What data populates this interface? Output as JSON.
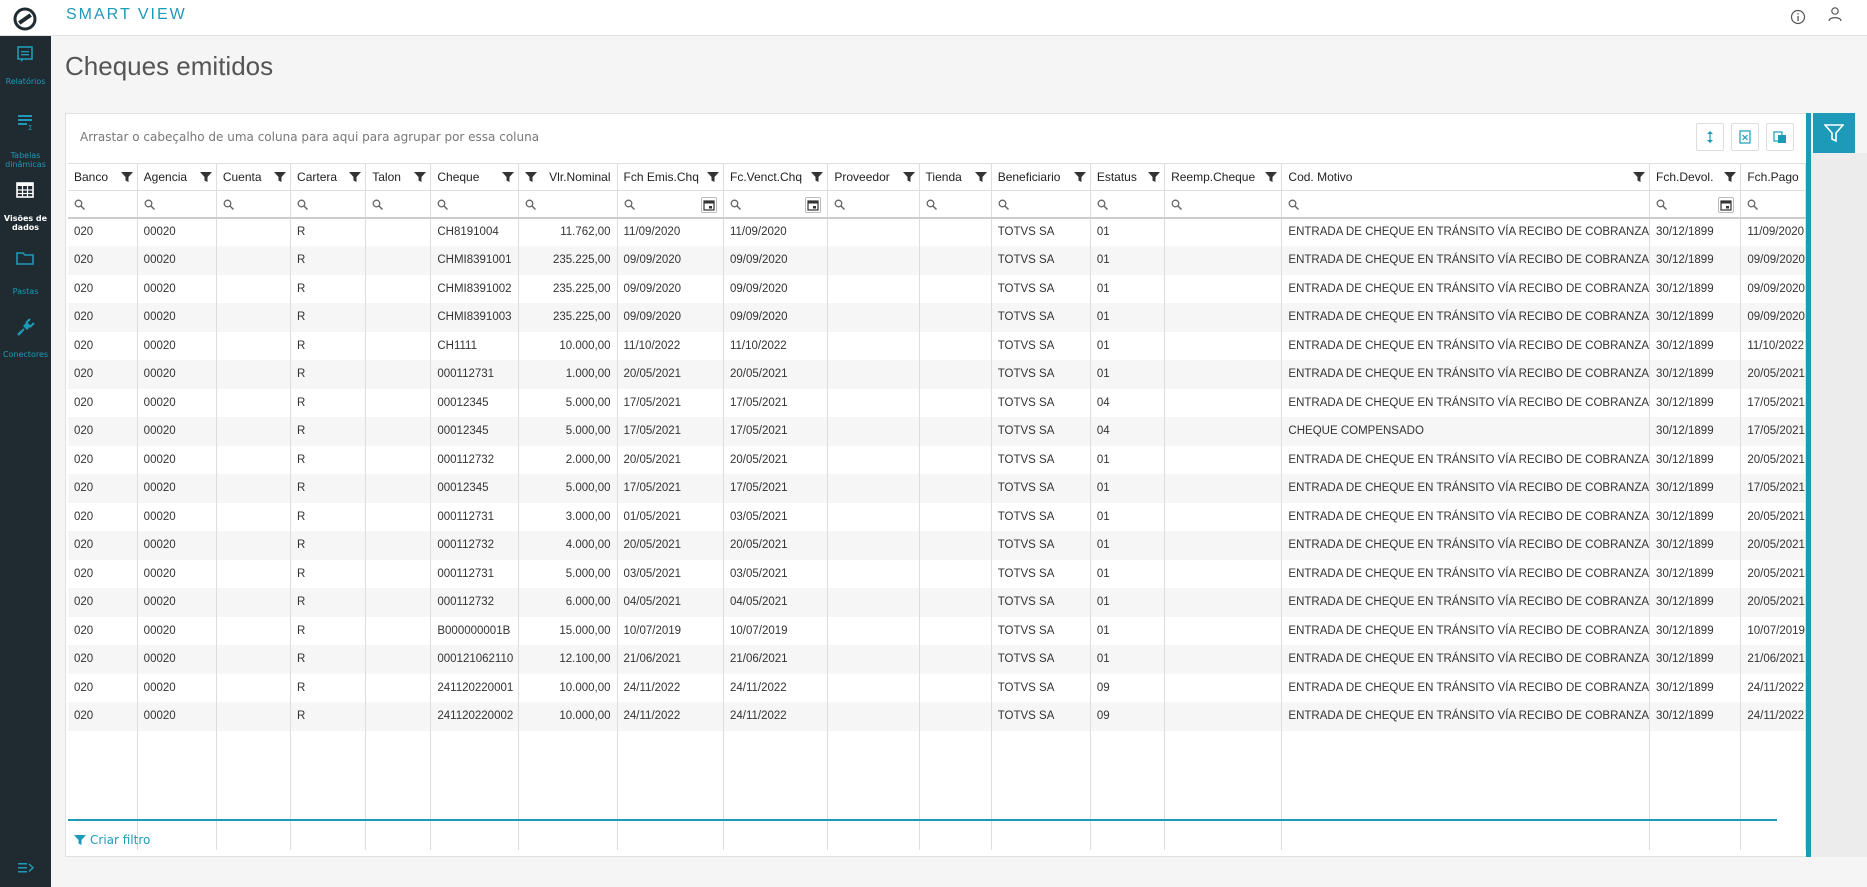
{
  "app": {
    "title": "SMART VIEW"
  },
  "topbar": {
    "icons": [
      "info-icon",
      "user-icon"
    ]
  },
  "sidenav": {
    "items": [
      {
        "label": "Relatórios",
        "icon": "report-icon"
      },
      {
        "label": "Tabelas dinâmicas",
        "icon": "pivot-table-icon"
      },
      {
        "label": "Visões de dados",
        "icon": "data-grid-icon",
        "active": true
      },
      {
        "label": "Pastas",
        "icon": "folder-icon"
      },
      {
        "label": "Conectores",
        "icon": "plug-icon"
      }
    ]
  },
  "page": {
    "title": "Cheques emitidos"
  },
  "grid": {
    "group_hint": "Arrastar o cabeçalho de uma coluna para aqui para agrupar por essa coluna",
    "create_filter": "Criar filtro",
    "columns": [
      "Banco",
      "Agencia",
      "Cuenta",
      "Cartera",
      "Talon",
      "Cheque",
      "Vlr.Nominal",
      "Fch Emis.Chq",
      "Fc.Venct.Chq",
      "Proveedor",
      "Tienda",
      "Beneficiario",
      "Estatus",
      "Reemp.Cheque",
      "Cod. Motivo",
      "Fch.Devol.",
      "Fch.Pago"
    ],
    "rows": [
      [
        "020",
        "00020",
        "",
        "R",
        "",
        "CH8191004",
        "11.762,00",
        "11/09/2020",
        "11/09/2020",
        "",
        "",
        "TOTVS SA",
        "01",
        "",
        "ENTRADA DE CHEQUE EN TRÁNSITO VÍA RECIBO DE COBRANZA",
        "30/12/1899",
        "11/09/2020"
      ],
      [
        "020",
        "00020",
        "",
        "R",
        "",
        "CHMI8391001",
        "235.225,00",
        "09/09/2020",
        "09/09/2020",
        "",
        "",
        "TOTVS SA",
        "01",
        "",
        "ENTRADA DE CHEQUE EN TRÁNSITO VÍA RECIBO DE COBRANZA",
        "30/12/1899",
        "09/09/2020"
      ],
      [
        "020",
        "00020",
        "",
        "R",
        "",
        "CHMI8391002",
        "235.225,00",
        "09/09/2020",
        "09/09/2020",
        "",
        "",
        "TOTVS SA",
        "01",
        "",
        "ENTRADA DE CHEQUE EN TRÁNSITO VÍA RECIBO DE COBRANZA",
        "30/12/1899",
        "09/09/2020"
      ],
      [
        "020",
        "00020",
        "",
        "R",
        "",
        "CHMI8391003",
        "235.225,00",
        "09/09/2020",
        "09/09/2020",
        "",
        "",
        "TOTVS SA",
        "01",
        "",
        "ENTRADA DE CHEQUE EN TRÁNSITO VÍA RECIBO DE COBRANZA",
        "30/12/1899",
        "09/09/2020"
      ],
      [
        "020",
        "00020",
        "",
        "R",
        "",
        "CH1111",
        "10.000,00",
        "11/10/2022",
        "11/10/2022",
        "",
        "",
        "TOTVS SA",
        "01",
        "",
        "ENTRADA DE CHEQUE EN TRÁNSITO VÍA RECIBO DE COBRANZA",
        "30/12/1899",
        "11/10/2022"
      ],
      [
        "020",
        "00020",
        "",
        "R",
        "",
        "000112731",
        "1.000,00",
        "20/05/2021",
        "20/05/2021",
        "",
        "",
        "TOTVS SA",
        "01",
        "",
        "ENTRADA DE CHEQUE EN TRÁNSITO VÍA RECIBO DE COBRANZA",
        "30/12/1899",
        "20/05/2021"
      ],
      [
        "020",
        "00020",
        "",
        "R",
        "",
        "00012345",
        "5.000,00",
        "17/05/2021",
        "17/05/2021",
        "",
        "",
        "TOTVS SA",
        "04",
        "",
        "ENTRADA DE CHEQUE EN TRÁNSITO VÍA RECIBO DE COBRANZA",
        "30/12/1899",
        "17/05/2021"
      ],
      [
        "020",
        "00020",
        "",
        "R",
        "",
        "00012345",
        "5.000,00",
        "17/05/2021",
        "17/05/2021",
        "",
        "",
        "TOTVS SA",
        "04",
        "",
        "CHEQUE COMPENSADO",
        "30/12/1899",
        "17/05/2021"
      ],
      [
        "020",
        "00020",
        "",
        "R",
        "",
        "000112732",
        "2.000,00",
        "20/05/2021",
        "20/05/2021",
        "",
        "",
        "TOTVS SA",
        "01",
        "",
        "ENTRADA DE CHEQUE EN TRÁNSITO VÍA RECIBO DE COBRANZA",
        "30/12/1899",
        "20/05/2021"
      ],
      [
        "020",
        "00020",
        "",
        "R",
        "",
        "00012345",
        "5.000,00",
        "17/05/2021",
        "17/05/2021",
        "",
        "",
        "TOTVS SA",
        "01",
        "",
        "ENTRADA DE CHEQUE EN TRÁNSITO VÍA RECIBO DE COBRANZA",
        "30/12/1899",
        "17/05/2021"
      ],
      [
        "020",
        "00020",
        "",
        "R",
        "",
        "000112731",
        "3.000,00",
        "01/05/2021",
        "03/05/2021",
        "",
        "",
        "TOTVS SA",
        "01",
        "",
        "ENTRADA DE CHEQUE EN TRÁNSITO VÍA RECIBO DE COBRANZA",
        "30/12/1899",
        "20/05/2021"
      ],
      [
        "020",
        "00020",
        "",
        "R",
        "",
        "000112732",
        "4.000,00",
        "20/05/2021",
        "20/05/2021",
        "",
        "",
        "TOTVS SA",
        "01",
        "",
        "ENTRADA DE CHEQUE EN TRÁNSITO VÍA RECIBO DE COBRANZA",
        "30/12/1899",
        "20/05/2021"
      ],
      [
        "020",
        "00020",
        "",
        "R",
        "",
        "000112731",
        "5.000,00",
        "03/05/2021",
        "03/05/2021",
        "",
        "",
        "TOTVS SA",
        "01",
        "",
        "ENTRADA DE CHEQUE EN TRÁNSITO VÍA RECIBO DE COBRANZA",
        "30/12/1899",
        "20/05/2021"
      ],
      [
        "020",
        "00020",
        "",
        "R",
        "",
        "000112732",
        "6.000,00",
        "04/05/2021",
        "04/05/2021",
        "",
        "",
        "TOTVS SA",
        "01",
        "",
        "ENTRADA DE CHEQUE EN TRÁNSITO VÍA RECIBO DE COBRANZA",
        "30/12/1899",
        "20/05/2021"
      ],
      [
        "020",
        "00020",
        "",
        "R",
        "",
        "B000000001B",
        "15.000,00",
        "10/07/2019",
        "10/07/2019",
        "",
        "",
        "TOTVS SA",
        "01",
        "",
        "ENTRADA DE CHEQUE EN TRÁNSITO VÍA RECIBO DE COBRANZA",
        "30/12/1899",
        "10/07/2019"
      ],
      [
        "020",
        "00020",
        "",
        "R",
        "",
        "000121062110",
        "12.100,00",
        "21/06/2021",
        "21/06/2021",
        "",
        "",
        "TOTVS SA",
        "01",
        "",
        "ENTRADA DE CHEQUE EN TRÁNSITO VÍA RECIBO DE COBRANZA",
        "30/12/1899",
        "21/06/2021"
      ],
      [
        "020",
        "00020",
        "",
        "R",
        "",
        "241120220001",
        "10.000,00",
        "24/11/2022",
        "24/11/2022",
        "",
        "",
        "TOTVS SA",
        "09",
        "",
        "ENTRADA DE CHEQUE EN TRÁNSITO VÍA RECIBO DE COBRANZA",
        "30/12/1899",
        "24/11/2022"
      ],
      [
        "020",
        "00020",
        "",
        "R",
        "",
        "241120220002",
        "10.000,00",
        "24/11/2022",
        "24/11/2022",
        "",
        "",
        "TOTVS SA",
        "09",
        "",
        "ENTRADA DE CHEQUE EN TRÁNSITO VÍA RECIBO DE COBRANZA",
        "30/12/1899",
        "24/11/2022"
      ]
    ]
  },
  "colors": {
    "accent": "#1d9ab8",
    "nav_bg": "#1f2b31"
  }
}
